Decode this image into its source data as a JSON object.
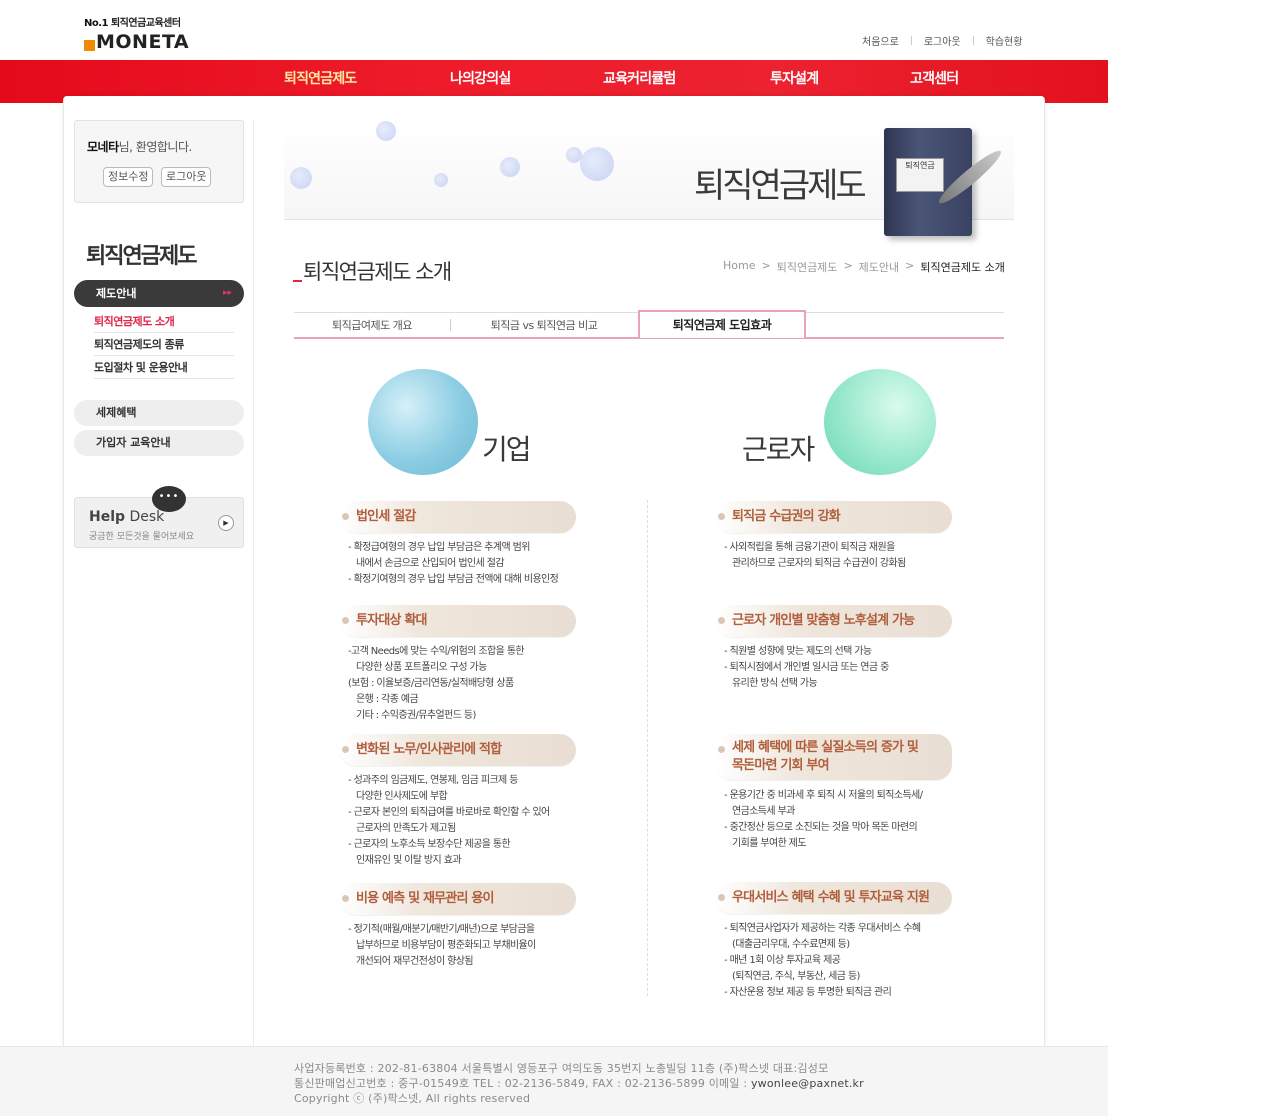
{
  "logo": {
    "tagline_no": "No.1",
    "tagline": "퇴직연금교육센터",
    "name": "MONETA",
    "accent_color": "#f08a00"
  },
  "top_links": [
    "처음으로",
    "로그아웃",
    "학습현황"
  ],
  "gnb": {
    "items": [
      "퇴직연금제도",
      "나의강의실",
      "교육커리큘럼",
      "투자설계",
      "고객센터"
    ],
    "active_index": 0,
    "bg_color": "#e8101f"
  },
  "login_box": {
    "user": "모네타",
    "greeting": "님, 환영합니다.",
    "edit_button": "정보수정",
    "logout_button": "로그아웃"
  },
  "sidebar": {
    "title": "퇴직연금제도",
    "active_menu": "제도안내",
    "sub_items": [
      "퇴직연금제도 소개",
      "퇴직연금제도의 종류",
      "도입절차 및 운용안내"
    ],
    "sub_active_index": 0,
    "menus": [
      "세제혜택",
      "가입자 교육안내"
    ],
    "help": {
      "title_bold": "Help",
      "title_rest": " Desk",
      "subtitle": "궁금한 모든것을 물어보세요",
      "bubble": "•••"
    }
  },
  "visual": {
    "title": "퇴직연금제도",
    "book_label": "퇴직연금"
  },
  "page_title": "퇴직연금제도 소개",
  "breadcrumb": [
    "Home",
    "퇴직연금제도",
    "제도안내",
    "퇴직연금제도 소개"
  ],
  "tabs": {
    "items": [
      "퇴직급여제도 개요",
      "퇴직금 vs 퇴직연금 비교",
      "퇴직연금제 도입효과"
    ],
    "active_index": 2
  },
  "columns": {
    "left": {
      "label": "기업",
      "orb_color": "#7cc4dc",
      "sections": [
        {
          "title": "법인세 절감",
          "lines": [
            "- 확정급여형의 경우 납입 부담금은 추계액 범위",
            "내에서 손금으로 산입되어 법인세 절감",
            "- 확정기여형의 경우 납입 부담금 전액에 대해 비용인정"
          ]
        },
        {
          "title": "투자대상 확대",
          "lines": [
            "-고객 Needs에 맞는 수익/위험의 조합을 통한",
            "다양한 상품 포트폴리오 구성 가능",
            "(보험 : 이율보증/금리연동/실적배당형 상품",
            "은행 : 각종 예금",
            "기타 : 수익증권/뮤추얼펀드 등)"
          ]
        },
        {
          "title": "변화된 노무/인사관리에 적합",
          "lines": [
            "- 성과주의 임금제도, 연봉제, 임금 피크제 등",
            "다양한 인사제도에 부합",
            "- 근로자 본인의 퇴직급여를 바로바로 확인할 수 있어",
            "근로자의 만족도가 제고됨",
            "- 근로자의 노후소득 보장수단 제공을 통한",
            "인재유인 및 이탈 방지 효과"
          ]
        },
        {
          "title": "비용 예측 및 재무관리 용이",
          "lines": [
            "- 정기적(매월/매분기/매반기/매년)으로 부담금을",
            "납부하므로 비용부담이 평준화되고 부채비율이",
            "개선되어 재무건전성이 향상됨"
          ]
        }
      ]
    },
    "right": {
      "label": "근로자",
      "orb_color": "#8fe3c6",
      "sections": [
        {
          "title": "퇴직금 수급권의 강화",
          "lines": [
            "- 사외적립을 통해 금융기관이 퇴직금 재원을",
            "관리하므로 근로자의 퇴직금 수급권이 강화됨"
          ]
        },
        {
          "title": "근로자 개인별 맞춤형 노후설계 가능",
          "lines": [
            "- 직원별 성향에 맞는 제도의 선택 가능",
            "- 퇴직시점에서 개인별 일시금 또는 연금 중",
            "유리한 방식 선택 가능"
          ]
        },
        {
          "title": "세제 혜택에 따른 실질소득의 증가 및",
          "title2": "목돈마련 기회 부여",
          "lines": [
            "- 운용기간 중 비과세 후 퇴직 시 저율의 퇴직소득세/",
            "연금소득세 부과",
            "- 중간정산 등으로 소진되는 것을 막아 목돈 마련의",
            "기회를 부여한 제도"
          ]
        },
        {
          "title": "우대서비스 혜택 수혜 및 투자교육 지원",
          "lines": [
            "- 퇴직연금사업자가 제공하는 각종 우대서비스 수혜",
            "(대출금리우대, 수수료면제 등)",
            "- 매년 1회 이상 투자교육 제공",
            "(퇴직연금, 주식, 부동산, 세금 등)",
            "- 자산운용 정보 제공 등 투명한 퇴직금 관리"
          ]
        }
      ]
    }
  },
  "footer": {
    "line1": "사업자등록번호 : 202-81-63804 서울특별시 영등포구 여의도동 35번지 노총빌딩 11층 (주)팍스넷 대표:김성모",
    "line2": "통신판매업신고번호 : 중구-01549호 TEL : 02-2136-5849, FAX : 02-2136-5899 이메일 : ",
    "email": "ywonlee@paxnet.kr",
    "line3": "Copyright ⓒ (주)팍스넷, All rights reserved"
  }
}
